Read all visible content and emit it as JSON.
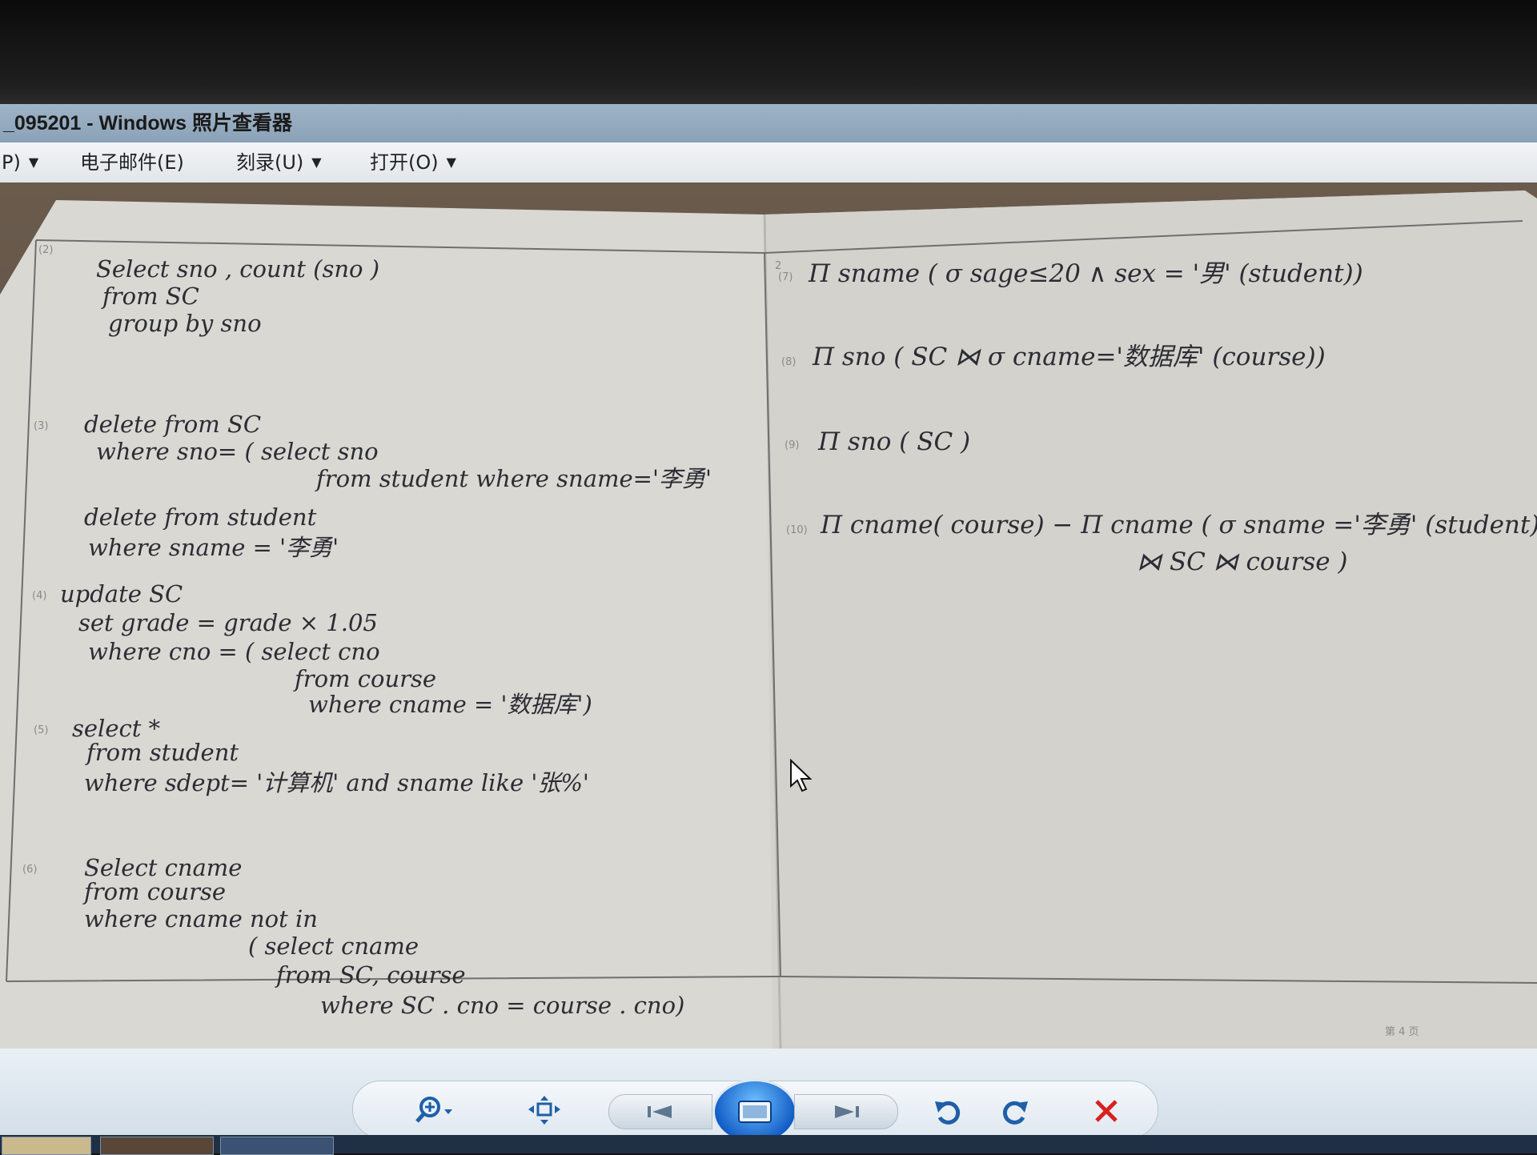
{
  "window": {
    "title": "_095201 - Windows 照片查看器"
  },
  "menubar": {
    "items": [
      {
        "label": "P)"
      },
      {
        "label": "电子邮件(E)"
      },
      {
        "label": "刻录(U)"
      },
      {
        "label": "打开(O)"
      }
    ]
  },
  "photo": {
    "left_page": [
      {
        "number": "(2)",
        "lines": [
          "Select   sno , count (sno )",
          "from  SC",
          "group  by  sno"
        ]
      },
      {
        "number": "(3)",
        "lines": [
          "delete  from SC",
          "where  sno= ( select  sno",
          "from  student  where  sname='李勇'",
          "delete  from  student",
          "where  sname = '李勇'"
        ]
      },
      {
        "number": "(4)",
        "lines": [
          "update  SC",
          "set   grade = grade × 1.05",
          "where  cno = ( select  cno",
          "from  course",
          "where  cname = '数据库')"
        ]
      },
      {
        "number": "(5)",
        "lines": [
          "select  *",
          "from  student",
          "where  sdept= '计算机' and  sname like '张%'"
        ]
      },
      {
        "number": "(6)",
        "lines": [
          "Select  cname",
          "from  course",
          "where  cname  not  in",
          "( select  cname",
          "from  SC, course",
          "where   SC . cno  = course . cno)"
        ]
      }
    ],
    "right_page": [
      {
        "number": "(7)",
        "lines": [
          "Π sname ( σ sage≤20  ∧ sex = '男' (student))"
        ]
      },
      {
        "number": "(8)",
        "lines": [
          "Π sno  ( SC ⋈ σ cname='数据库' (course))"
        ]
      },
      {
        "number": "(9)",
        "lines": [
          "Π sno  ( SC )"
        ]
      },
      {
        "number": "(10)",
        "lines": [
          "Π cname( course) − Π cname ( σ sname ='李勇' (student)",
          "⋈ SC ⋈ course )"
        ]
      }
    ],
    "right_page_marker": "2",
    "footer": "第  4  页"
  },
  "toolbar": {
    "buttons": [
      {
        "icon": "zoom-icon"
      },
      {
        "icon": "fit-to-window-icon"
      },
      {
        "icon": "previous-icon"
      },
      {
        "icon": "slideshow-icon"
      },
      {
        "icon": "next-icon"
      },
      {
        "icon": "rotate-left-icon"
      },
      {
        "icon": "rotate-right-icon"
      },
      {
        "icon": "delete-icon"
      }
    ]
  },
  "colors": {
    "titlebar": "#8fa6bc",
    "ink": "#2c2c34",
    "paper": "#d9d8d3",
    "delete_red": "#d92020"
  }
}
